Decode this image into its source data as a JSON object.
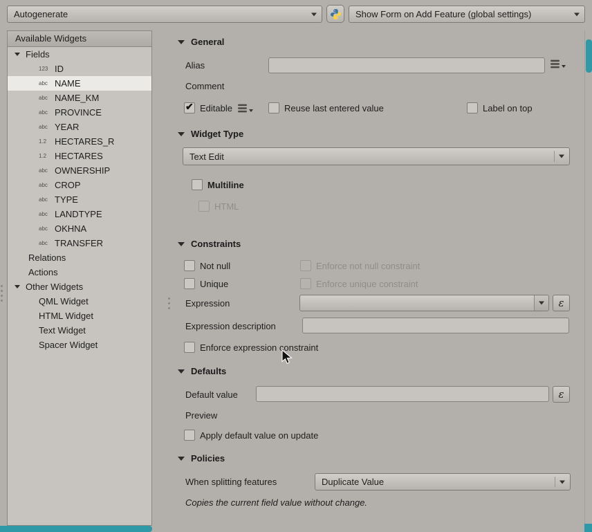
{
  "topbar": {
    "layout_combo": {
      "value": "Autogenerate"
    },
    "form_mode_combo": {
      "value": "Show Form on Add Feature (global settings)"
    }
  },
  "sidebar": {
    "title": "Available Widgets",
    "items": [
      {
        "label": "Fields"
      },
      {
        "label": "ID",
        "icon": "123"
      },
      {
        "label": "NAME",
        "icon": "abc",
        "selected": true
      },
      {
        "label": "NAME_KM",
        "icon": "abc"
      },
      {
        "label": "PROVINCE",
        "icon": "abc"
      },
      {
        "label": "YEAR",
        "icon": "abc"
      },
      {
        "label": "HECTARES_R",
        "icon": "1.2"
      },
      {
        "label": "HECTARES",
        "icon": "1.2"
      },
      {
        "label": "OWNERSHIP",
        "icon": "abc"
      },
      {
        "label": "CROP",
        "icon": "abc"
      },
      {
        "label": "TYPE",
        "icon": "abc"
      },
      {
        "label": "LANDTYPE",
        "icon": "abc"
      },
      {
        "label": "OKHNA",
        "icon": "abc"
      },
      {
        "label": "TRANSFER",
        "icon": "abc"
      },
      {
        "label": "Relations"
      },
      {
        "label": "Actions"
      },
      {
        "label": "Other Widgets"
      },
      {
        "label": "QML Widget"
      },
      {
        "label": "HTML Widget"
      },
      {
        "label": "Text Widget"
      },
      {
        "label": "Spacer Widget"
      }
    ]
  },
  "general": {
    "title": "General",
    "alias_label": "Alias",
    "alias_value": "",
    "comment_label": "Comment",
    "editable_label": "Editable",
    "editable_checked": true,
    "reuse_label": "Reuse last entered value",
    "label_on_top_label": "Label on top"
  },
  "widget_type": {
    "title": "Widget Type",
    "combo_value": "Text Edit",
    "multiline_label": "Multiline",
    "html_label": "HTML"
  },
  "constraints": {
    "title": "Constraints",
    "not_null_label": "Not null",
    "enforce_not_null_label": "Enforce not null constraint",
    "unique_label": "Unique",
    "enforce_unique_label": "Enforce unique constraint",
    "expression_label": "Expression",
    "expression_value": "",
    "expression_description_label": "Expression description",
    "expression_description_value": "",
    "enforce_expression_label": "Enforce expression constraint",
    "epsilon": "ε"
  },
  "defaults": {
    "title": "Defaults",
    "default_value_label": "Default value",
    "default_value": "",
    "preview_label": "Preview",
    "apply_on_update_label": "Apply default value on update",
    "epsilon": "ε"
  },
  "policies": {
    "title": "Policies",
    "split_label": "When splitting features",
    "split_value": "Duplicate Value",
    "note": "Copies the current field value without change."
  },
  "colors": {
    "accent_scrollbar": "#2f99a8",
    "selection_background": "#eceae6",
    "panel_background": "#b3b0ab"
  }
}
